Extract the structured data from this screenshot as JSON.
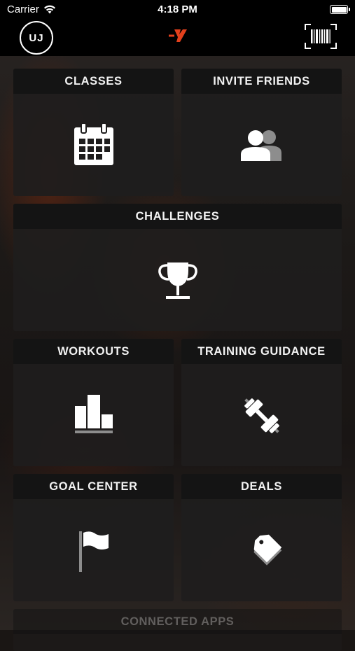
{
  "status_bar": {
    "carrier": "Carrier",
    "time": "4:18 PM",
    "wifi_icon": "wifi-icon",
    "battery_icon": "battery-icon"
  },
  "nav_bar": {
    "avatar_initials": "UJ",
    "logo_icon": "ymca-logo-icon",
    "barcode_icon": "barcode-scan-icon",
    "logo_color": "#e2401c"
  },
  "tiles": {
    "classes": {
      "label": "CLASSES",
      "icon": "calendar-icon"
    },
    "invite_friends": {
      "label": "INVITE FRIENDS",
      "icon": "people-icon"
    },
    "challenges": {
      "label": "CHALLENGES",
      "icon": "trophy-icon"
    },
    "workouts": {
      "label": "WORKOUTS",
      "icon": "bar-chart-icon"
    },
    "training_guidance": {
      "label": "TRAINING GUIDANCE",
      "icon": "dumbbell-icon"
    },
    "goal_center": {
      "label": "GOAL CENTER",
      "icon": "flag-icon"
    },
    "deals": {
      "label": "DEALS",
      "icon": "tag-icon"
    },
    "connected_apps": {
      "label": "CONNECTED APPS"
    }
  }
}
